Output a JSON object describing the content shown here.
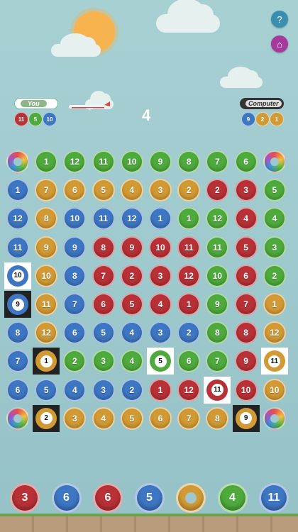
{
  "header": {
    "help_icon": "?",
    "home_icon": "⌂"
  },
  "players": {
    "you": {
      "label": "You",
      "balls": [
        {
          "n": "11",
          "c": "red"
        },
        {
          "n": "5",
          "c": "green"
        },
        {
          "n": "10",
          "c": "blue"
        }
      ]
    },
    "computer": {
      "label": "Computer",
      "balls": [
        {
          "n": "9",
          "c": "blue"
        },
        {
          "n": "2",
          "c": "orange"
        },
        {
          "n": "1",
          "c": "orange"
        }
      ]
    }
  },
  "score": "4",
  "board": [
    [
      {
        "t": "rainbow"
      },
      {
        "n": "1",
        "c": "green"
      },
      {
        "n": "12",
        "c": "green"
      },
      {
        "n": "11",
        "c": "green"
      },
      {
        "n": "10",
        "c": "green"
      },
      {
        "n": "9",
        "c": "green"
      },
      {
        "n": "8",
        "c": "green"
      },
      {
        "n": "7",
        "c": "green"
      },
      {
        "n": "6",
        "c": "green"
      },
      {
        "t": "rainbow"
      }
    ],
    [
      {
        "n": "1",
        "c": "blue"
      },
      {
        "n": "7",
        "c": "orange"
      },
      {
        "n": "6",
        "c": "orange"
      },
      {
        "n": "5",
        "c": "orange"
      },
      {
        "n": "4",
        "c": "orange"
      },
      {
        "n": "3",
        "c": "orange"
      },
      {
        "n": "2",
        "c": "orange"
      },
      {
        "n": "2",
        "c": "red"
      },
      {
        "n": "3",
        "c": "red"
      },
      {
        "n": "5",
        "c": "green"
      }
    ],
    [
      {
        "n": "12",
        "c": "blue"
      },
      {
        "n": "8",
        "c": "orange"
      },
      {
        "n": "10",
        "c": "blue"
      },
      {
        "n": "11",
        "c": "blue"
      },
      {
        "n": "12",
        "c": "blue"
      },
      {
        "n": "1",
        "c": "blue"
      },
      {
        "n": "1",
        "c": "green"
      },
      {
        "n": "12",
        "c": "green"
      },
      {
        "n": "4",
        "c": "red"
      },
      {
        "n": "4",
        "c": "green"
      }
    ],
    [
      {
        "n": "11",
        "c": "blue"
      },
      {
        "n": "9",
        "c": "orange"
      },
      {
        "n": "9",
        "c": "blue"
      },
      {
        "n": "8",
        "c": "red"
      },
      {
        "n": "9",
        "c": "red"
      },
      {
        "n": "10",
        "c": "red"
      },
      {
        "n": "11",
        "c": "red"
      },
      {
        "n": "11",
        "c": "green"
      },
      {
        "n": "5",
        "c": "red"
      },
      {
        "n": "3",
        "c": "green"
      }
    ],
    [
      {
        "n": "10",
        "c": "blue",
        "frame": "white"
      },
      {
        "n": "10",
        "c": "orange"
      },
      {
        "n": "8",
        "c": "blue"
      },
      {
        "n": "7",
        "c": "red"
      },
      {
        "n": "2",
        "c": "red"
      },
      {
        "n": "3",
        "c": "red"
      },
      {
        "n": "12",
        "c": "red"
      },
      {
        "n": "10",
        "c": "green"
      },
      {
        "n": "6",
        "c": "red"
      },
      {
        "n": "2",
        "c": "green"
      }
    ],
    [
      {
        "n": "9",
        "c": "blue",
        "frame": "black"
      },
      {
        "n": "11",
        "c": "orange"
      },
      {
        "n": "7",
        "c": "blue"
      },
      {
        "n": "6",
        "c": "red"
      },
      {
        "n": "5",
        "c": "red"
      },
      {
        "n": "4",
        "c": "red"
      },
      {
        "n": "1",
        "c": "red"
      },
      {
        "n": "9",
        "c": "green"
      },
      {
        "n": "7",
        "c": "red"
      },
      {
        "n": "1",
        "c": "orange"
      }
    ],
    [
      {
        "n": "8",
        "c": "blue"
      },
      {
        "n": "12",
        "c": "orange"
      },
      {
        "n": "6",
        "c": "blue"
      },
      {
        "n": "5",
        "c": "blue"
      },
      {
        "n": "4",
        "c": "blue"
      },
      {
        "n": "3",
        "c": "blue"
      },
      {
        "n": "2",
        "c": "blue"
      },
      {
        "n": "8",
        "c": "green"
      },
      {
        "n": "8",
        "c": "red"
      },
      {
        "n": "12",
        "c": "orange"
      }
    ],
    [
      {
        "n": "7",
        "c": "blue"
      },
      {
        "n": "1",
        "c": "orange",
        "frame": "black"
      },
      {
        "n": "2",
        "c": "green"
      },
      {
        "n": "3",
        "c": "green"
      },
      {
        "n": "4",
        "c": "green"
      },
      {
        "n": "5",
        "c": "green",
        "frame": "white"
      },
      {
        "n": "6",
        "c": "green"
      },
      {
        "n": "7",
        "c": "green"
      },
      {
        "n": "9",
        "c": "red"
      },
      {
        "n": "11",
        "c": "orange",
        "frame": "white"
      }
    ],
    [
      {
        "n": "6",
        "c": "blue"
      },
      {
        "n": "5",
        "c": "blue"
      },
      {
        "n": "4",
        "c": "blue"
      },
      {
        "n": "3",
        "c": "blue"
      },
      {
        "n": "2",
        "c": "blue"
      },
      {
        "n": "1",
        "c": "red"
      },
      {
        "n": "12",
        "c": "red"
      },
      {
        "n": "11",
        "c": "red",
        "frame": "white"
      },
      {
        "n": "10",
        "c": "red"
      },
      {
        "n": "10",
        "c": "orange"
      }
    ],
    [
      {
        "t": "rainbow"
      },
      {
        "n": "2",
        "c": "orange",
        "frame": "black"
      },
      {
        "n": "3",
        "c": "orange"
      },
      {
        "n": "4",
        "c": "orange"
      },
      {
        "n": "5",
        "c": "orange"
      },
      {
        "n": "6",
        "c": "orange"
      },
      {
        "n": "7",
        "c": "orange"
      },
      {
        "n": "8",
        "c": "orange"
      },
      {
        "n": "9",
        "c": "orange",
        "frame": "black"
      },
      {
        "t": "rainbow"
      }
    ]
  ],
  "hand": [
    {
      "n": "3",
      "c": "red"
    },
    {
      "n": "6",
      "c": "blue"
    },
    {
      "n": "6",
      "c": "red"
    },
    {
      "n": "5",
      "c": "blue"
    },
    {
      "n": "",
      "c": "orange",
      "hole": true
    },
    {
      "n": "4",
      "c": "green"
    },
    {
      "n": "11",
      "c": "blue"
    }
  ],
  "colors": {
    "green": "#4eaa3c",
    "blue": "#3d76c2",
    "orange": "#d29a34",
    "red": "#b73136"
  }
}
